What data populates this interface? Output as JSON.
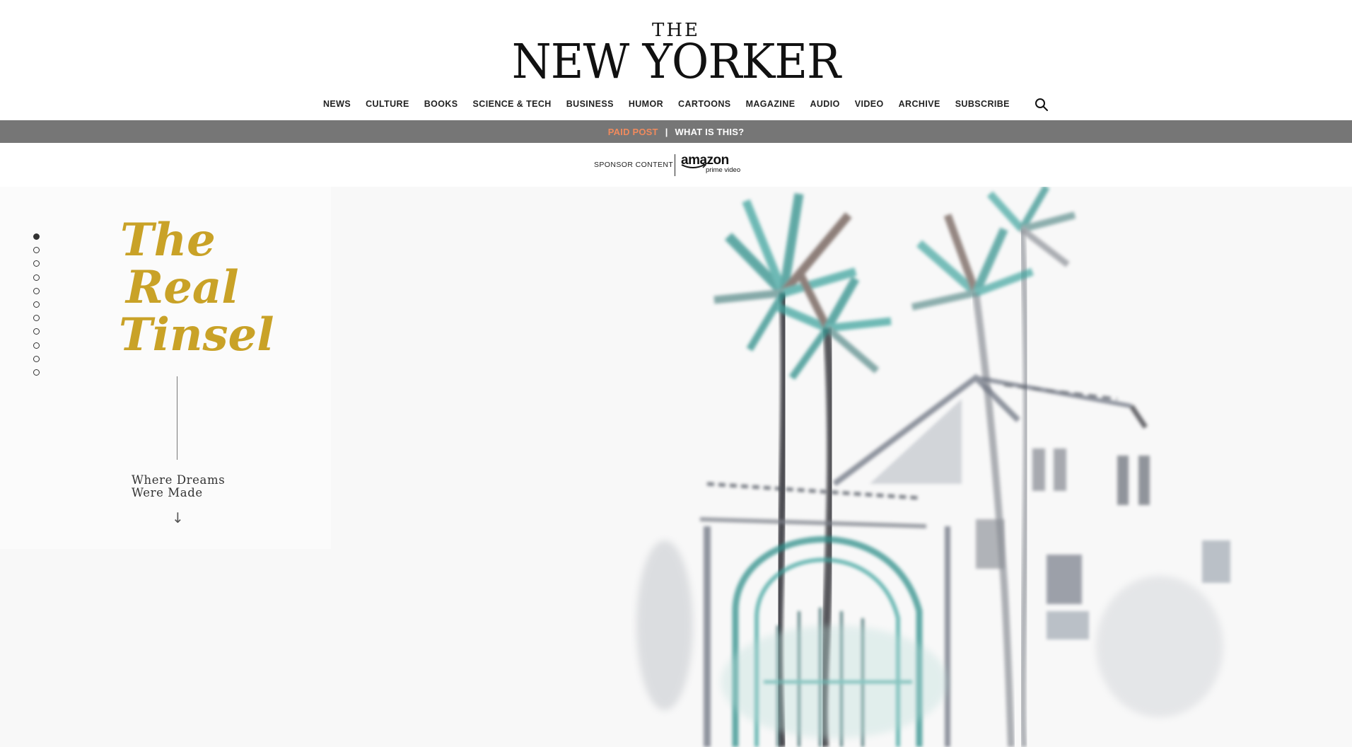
{
  "masthead": {
    "logo_top": "THE",
    "logo_main": "NEW YORKER"
  },
  "nav": {
    "items": [
      "NEWS",
      "CULTURE",
      "BOOKS",
      "SCIENCE & TECH",
      "BUSINESS",
      "HUMOR",
      "CARTOONS",
      "MAGAZINE",
      "AUDIO",
      "VIDEO",
      "ARCHIVE",
      "SUBSCRIBE"
    ],
    "search_icon": "search-icon"
  },
  "paid_bar": {
    "paid_label": "PAID POST",
    "separator": "|",
    "what_label": "WHAT IS THIS?",
    "paid_color": "#f08a5d",
    "bar_color": "#767676"
  },
  "sponsor": {
    "label": "SPONSOR CONTENT",
    "brand": "amazon",
    "brand_sub": "prime video"
  },
  "hero": {
    "title_lines": [
      "The",
      "Real",
      "Tinsel"
    ],
    "title_color": "#c9a227",
    "subtitle_lines": [
      "Where Dreams",
      "Were Made"
    ],
    "arrow": "↓",
    "section_count": 11,
    "active_section": 1
  }
}
